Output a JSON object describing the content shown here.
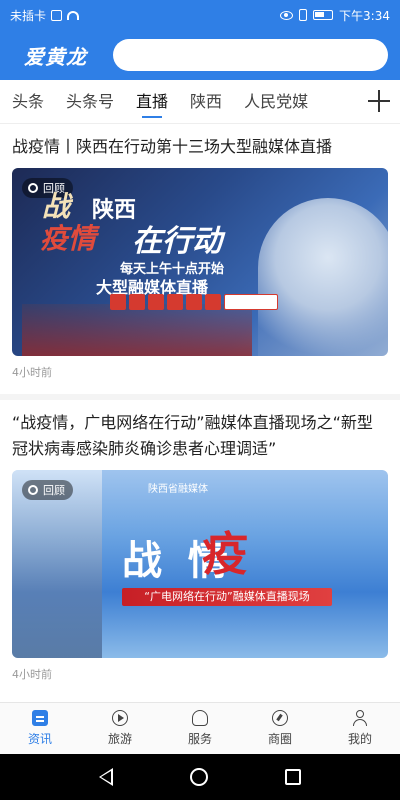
{
  "statusbar": {
    "carrier": "未插卡",
    "time": "下午3:34"
  },
  "header": {
    "logo": "爱黄龙",
    "search_placeholder": ""
  },
  "tabs": {
    "items": [
      "头条",
      "头条号",
      "直播",
      "陕西",
      "人民党媒"
    ],
    "active_index": 2
  },
  "feed": {
    "articles": [
      {
        "title": "战疫情丨陕西在行动第十三场大型融媒体直播",
        "badge": "回顾",
        "thumb": {
          "brush_1": "战",
          "brush_2": "疫情",
          "line_1": "陕西",
          "line_2": "在行动",
          "line_3": "每天上午十点开始",
          "line_4": "大型融媒体直播"
        },
        "meta": "4小时前"
      },
      {
        "title": "“战疫情，广电网络在行动”融媒体直播现场之“新型冠状病毒感染肺炎确诊患者心理调适”",
        "badge": "回顾",
        "thumb": {
          "top_text": "陕西省融媒体",
          "main": "战  情",
          "red": "疫",
          "bar": "“广电网络在行动”融媒体直播现场"
        },
        "meta": "4小时前"
      }
    ]
  },
  "bottomnav": {
    "items": [
      {
        "label": "资讯",
        "icon": "news-icon"
      },
      {
        "label": "旅游",
        "icon": "travel-icon"
      },
      {
        "label": "服务",
        "icon": "service-icon"
      },
      {
        "label": "商圈",
        "icon": "compass-icon"
      },
      {
        "label": "我的",
        "icon": "user-icon"
      }
    ],
    "active_index": 0
  },
  "colors": {
    "accent": "#2f7fe6",
    "highlight": "#d8262b"
  }
}
